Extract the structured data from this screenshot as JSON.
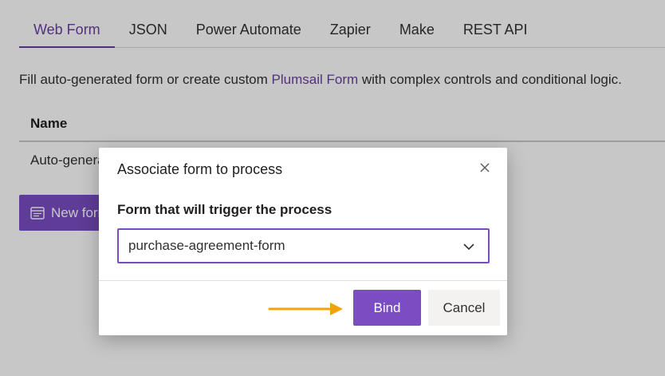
{
  "tabs": [
    {
      "label": "Web Form",
      "active": true
    },
    {
      "label": "JSON"
    },
    {
      "label": "Power Automate"
    },
    {
      "label": "Zapier"
    },
    {
      "label": "Make"
    },
    {
      "label": "REST API"
    }
  ],
  "description": {
    "before": "Fill auto-generated form or create custom ",
    "link": "Plumsail Form",
    "after": " with complex controls and conditional logic."
  },
  "table": {
    "header_name": "Name",
    "row_1_name": "Auto-generated"
  },
  "new_form_button": {
    "label": "New form",
    "icon": "form-icon"
  },
  "dialog": {
    "title": "Associate form to process",
    "field_label": "Form that will trigger the process",
    "select_value": "purchase-agreement-form",
    "bind_label": "Bind",
    "cancel_label": "Cancel"
  },
  "colors": {
    "accent": "#7a4ec2",
    "link": "#6b3fa0",
    "arrow": "#f0a30a"
  }
}
